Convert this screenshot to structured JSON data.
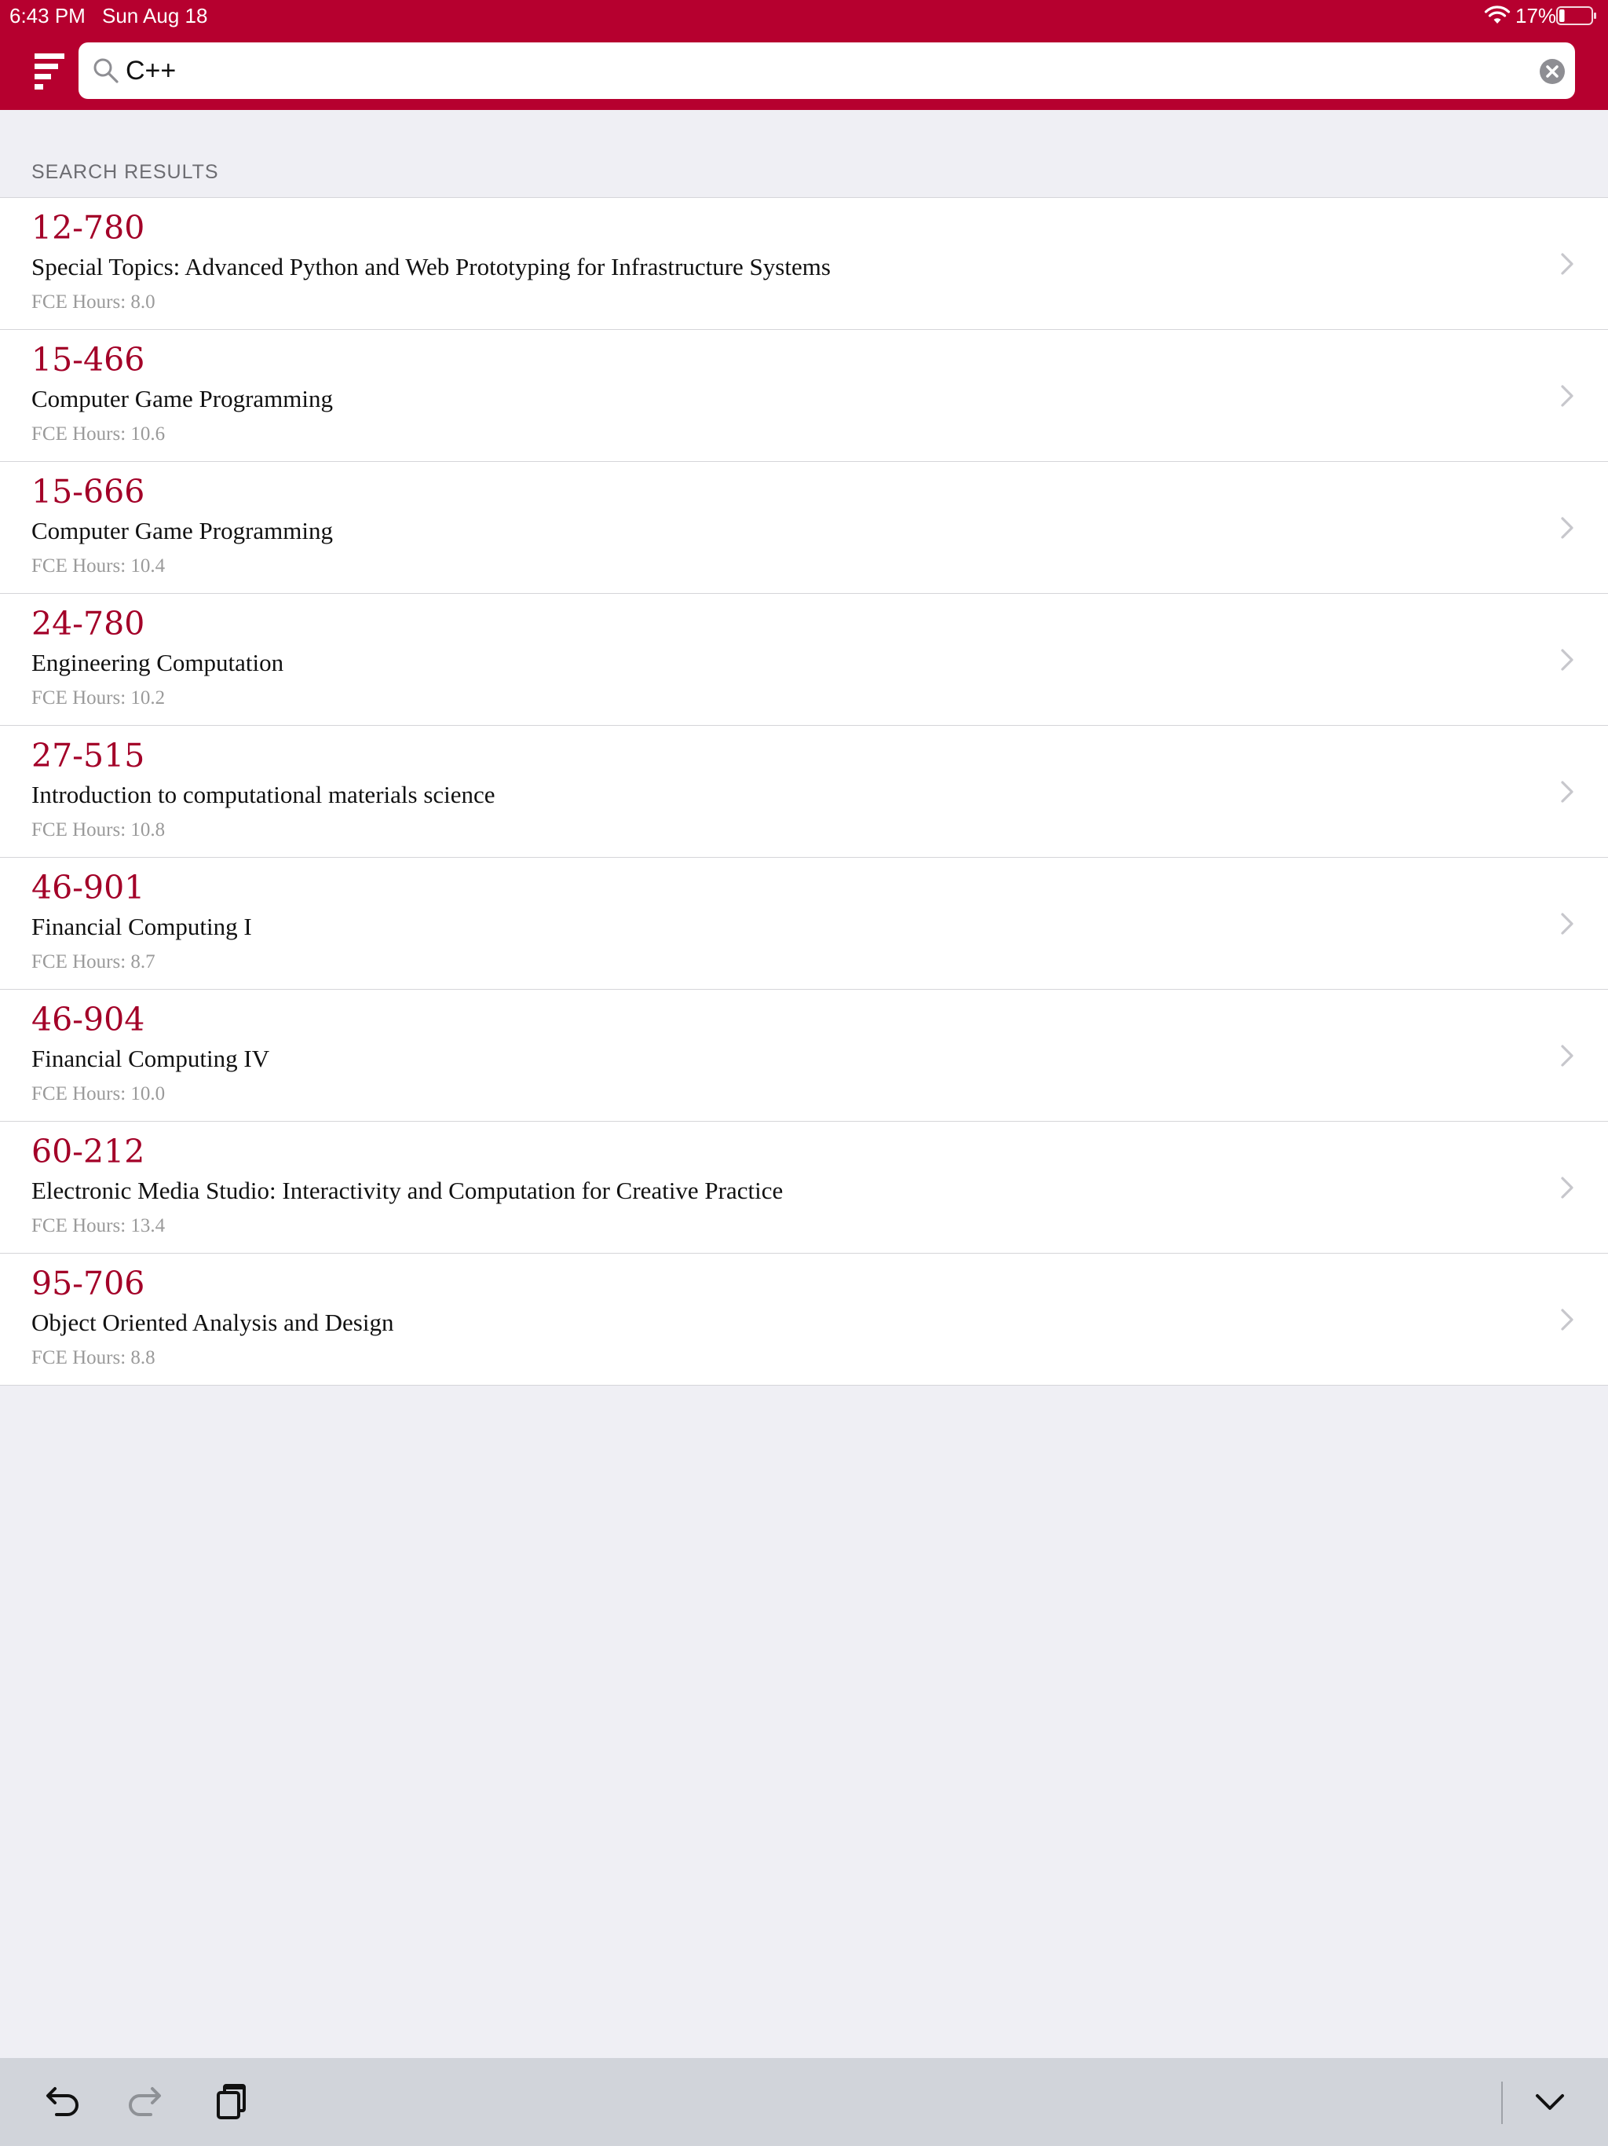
{
  "status_bar": {
    "time": "6:43 PM",
    "date": "Sun Aug 18",
    "battery_percent": "17%",
    "battery_level": 0.17
  },
  "search": {
    "query": "C++",
    "placeholder": ""
  },
  "section": {
    "header": "SEARCH RESULTS"
  },
  "results": [
    {
      "code": "12-780",
      "title": "Special Topics: Advanced Python and Web Prototyping for Infrastructure Systems",
      "fce": "FCE Hours: 8.0"
    },
    {
      "code": "15-466",
      "title": "Computer Game Programming",
      "fce": "FCE Hours: 10.6"
    },
    {
      "code": "15-666",
      "title": "Computer Game Programming",
      "fce": "FCE Hours: 10.4"
    },
    {
      "code": "24-780",
      "title": "Engineering Computation",
      "fce": "FCE Hours: 10.2"
    },
    {
      "code": "27-515",
      "title": "Introduction to computational materials science",
      "fce": "FCE Hours: 10.8"
    },
    {
      "code": "46-901",
      "title": "Financial Computing I",
      "fce": "FCE Hours: 8.7"
    },
    {
      "code": "46-904",
      "title": "Financial Computing IV",
      "fce": "FCE Hours: 10.0"
    },
    {
      "code": "60-212",
      "title": "Electronic Media Studio: Interactivity and Computation for Creative Practice",
      "fce": "FCE Hours: 13.4"
    },
    {
      "code": "95-706",
      "title": "Object Oriented Analysis and Design",
      "fce": "FCE Hours: 8.8"
    }
  ],
  "colors": {
    "brand": "#b6002f",
    "course_code": "#a30028",
    "background": "#efeff4"
  },
  "icons": {
    "menu": "menu-icon",
    "search": "search-icon",
    "clear": "clear-icon",
    "chevron": "chevron-right-icon",
    "undo": "undo-icon",
    "redo": "redo-icon",
    "paste": "paste-icon",
    "dismiss_keyboard": "chevron-down-icon"
  }
}
